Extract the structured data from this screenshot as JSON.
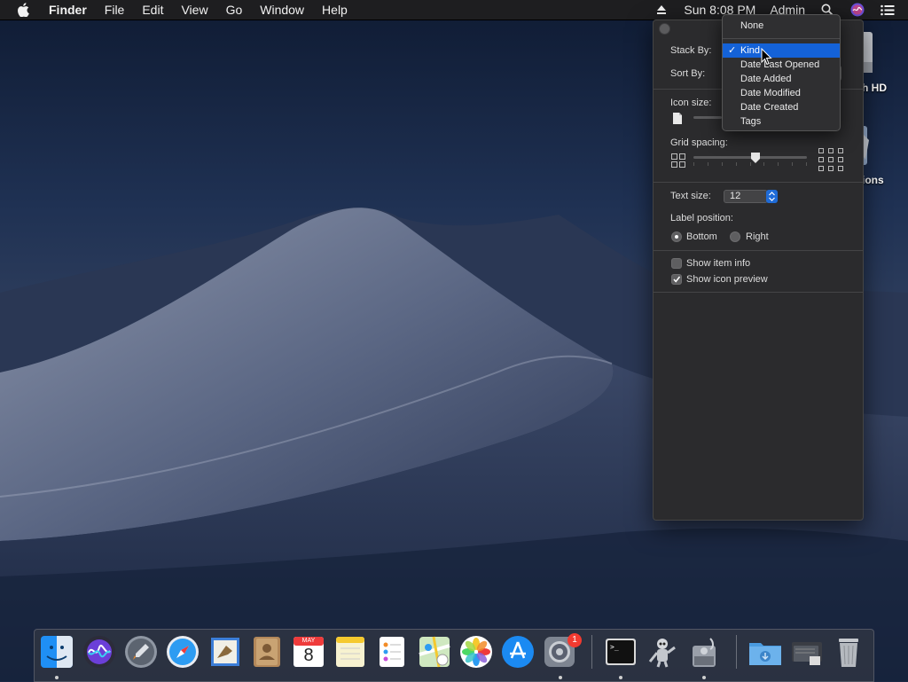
{
  "menubar": {
    "app_name": "Finder",
    "menus": [
      "File",
      "Edit",
      "View",
      "Go",
      "Window",
      "Help"
    ],
    "clock": "Sun 8:08 PM",
    "user": "Admin"
  },
  "desktop": {
    "icon_labels": [
      "h HD",
      "ions"
    ]
  },
  "view_options": {
    "stack_by_label": "Stack By:",
    "sort_by_label": "Sort By:",
    "icon_size_label": "Icon size:",
    "grid_spacing_label": "Grid spacing:",
    "grid_spacing_value": 0.55,
    "text_size_label": "Text size:",
    "text_size_value": "12",
    "label_position_label": "Label position:",
    "label_position_options": [
      "Bottom",
      "Right"
    ],
    "label_position_selected": "Bottom",
    "show_item_info_label": "Show item info",
    "show_item_info_checked": false,
    "show_icon_preview_label": "Show icon preview",
    "show_icon_preview_checked": true
  },
  "stack_dropdown": {
    "items": [
      "None",
      "Kind",
      "Date Last Opened",
      "Date Added",
      "Date Modified",
      "Date Created",
      "Tags"
    ],
    "selected": "Kind"
  },
  "dock": {
    "apps": [
      "finder",
      "siri",
      "launchpad",
      "safari",
      "mail",
      "contacts",
      "calendar",
      "notes",
      "reminders",
      "maps",
      "photos",
      "app-store",
      "system-preferences",
      "terminal",
      "automator",
      "disk-utility",
      "downloads",
      "documents",
      "trash"
    ],
    "calendar_month": "MAY",
    "calendar_day": "8",
    "system_preferences_badge": "1"
  },
  "colors": {
    "accent": "#1462d8",
    "panel_bg": "#2b2b2d",
    "menubar_bg": "#1e1e20"
  }
}
